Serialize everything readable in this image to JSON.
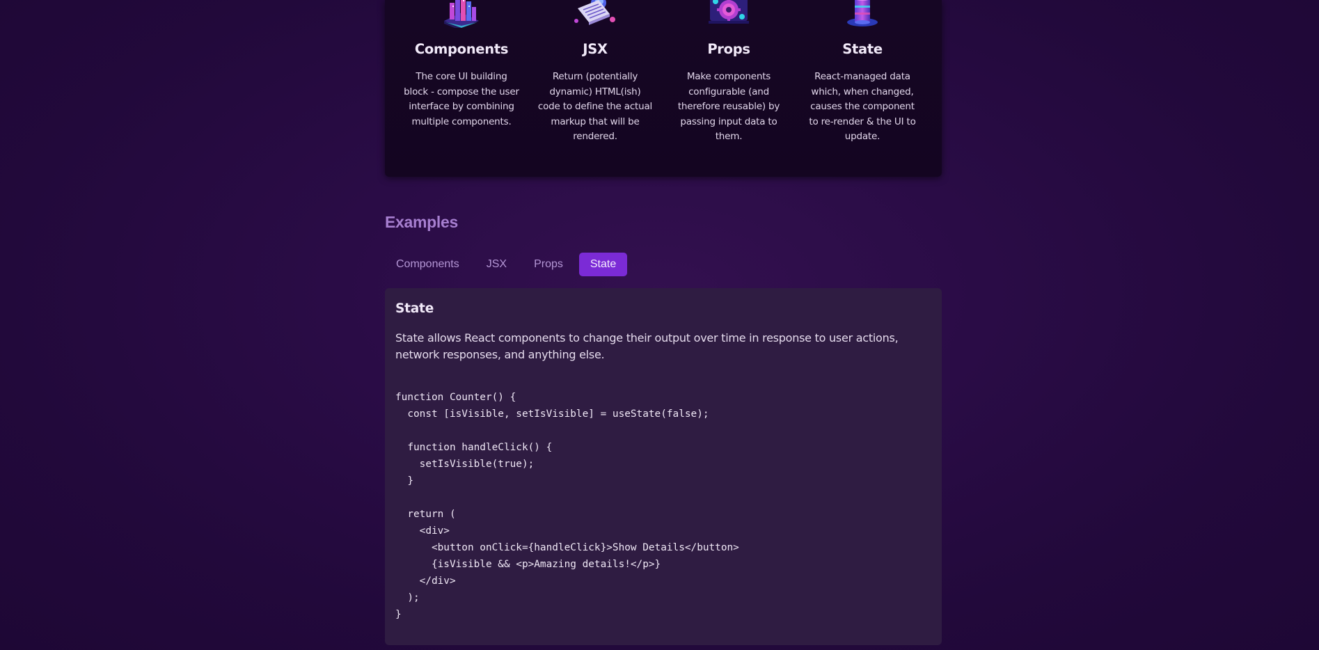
{
  "concepts": [
    {
      "icon": "components-icon",
      "title": "Components",
      "description": "The core UI building block - compose the user interface by combining multiple components."
    },
    {
      "icon": "jsx-icon",
      "title": "JSX",
      "description": "Return (potentially dynamic) HTML(ish) code to define the actual markup that will be rendered."
    },
    {
      "icon": "props-icon",
      "title": "Props",
      "description": "Make components configurable (and therefore reusable) by passing input data to them."
    },
    {
      "icon": "state-icon",
      "title": "State",
      "description": "React-managed data which, when changed, causes the component to re-render & the UI to update."
    }
  ],
  "examples": {
    "heading": "Examples",
    "tabs": [
      {
        "label": "Components",
        "active": false
      },
      {
        "label": "JSX",
        "active": false
      },
      {
        "label": "Props",
        "active": false
      },
      {
        "label": "State",
        "active": true
      }
    ],
    "panel": {
      "title": "State",
      "description": "State allows React components to change their output over time in response to user actions, network responses, and anything else.",
      "code": "function Counter() {\n  const [isVisible, setIsVisible] = useState(false);\n\n  function handleClick() {\n    setIsVisible(true);\n  }\n\n  return (\n    <div>\n      <button onClick={handleClick}>Show Details</button>\n      {isVisible && <p>Amazing details!</p>}\n    </div>\n  );\n}"
    }
  },
  "colors": {
    "background": "#2a0c46",
    "card": "#160624",
    "panel": "#2f1c42",
    "accent": "#7b2bd6",
    "heading": "#a77fd0",
    "tab_text": "#b597d6"
  }
}
